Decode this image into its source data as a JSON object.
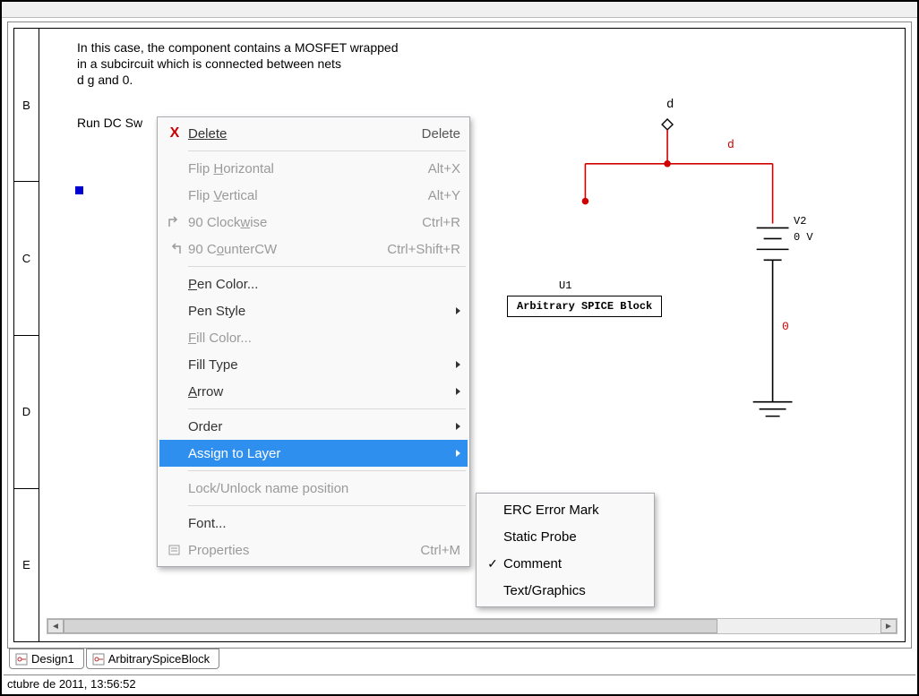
{
  "rows": [
    "B",
    "C",
    "D",
    "E"
  ],
  "canvas": {
    "desc_line1": "In this case, the component contains a MOSFET wrapped",
    "desc_line2": "in a subcircuit which is connected between nets",
    "desc_line3": "d g and 0.",
    "run_line": "Run DC Sw"
  },
  "schematic": {
    "net_d": "d",
    "wire_d": "d",
    "wire_0": "0",
    "u1_ref": "U1",
    "u1_name": "Arbitrary SPICE Block",
    "v2_ref": "V2",
    "v2_val": "0 V"
  },
  "menu": {
    "delete": "Delete",
    "delete_sc": "Delete",
    "flip_h": "Flip Horizontal",
    "flip_h_sc": "Alt+X",
    "flip_v": "Flip Vertical",
    "flip_v_sc": "Alt+Y",
    "rot_cw": "90 Clockwise",
    "rot_cw_sc": "Ctrl+R",
    "rot_ccw": "90 CounterCW",
    "rot_ccw_sc": "Ctrl+Shift+R",
    "pen_color": "Pen Color...",
    "pen_style": "Pen Style",
    "fill_color": "Fill Color...",
    "fill_type": "Fill Type",
    "arrow": "Arrow",
    "order": "Order",
    "assign_layer": "Assign to Layer",
    "lock_unlock": "Lock/Unlock name position",
    "font": "Font...",
    "properties": "Properties",
    "properties_sc": "Ctrl+M"
  },
  "submenu": {
    "erc": "ERC Error Mark",
    "static_probe": "Static Probe",
    "comment": "Comment",
    "text_graphics": "Text/Graphics"
  },
  "tabs": {
    "design1": "Design1",
    "arb": "ArbitrarySpiceBlock"
  },
  "status": "ctubre de 2011, 13:56:52"
}
